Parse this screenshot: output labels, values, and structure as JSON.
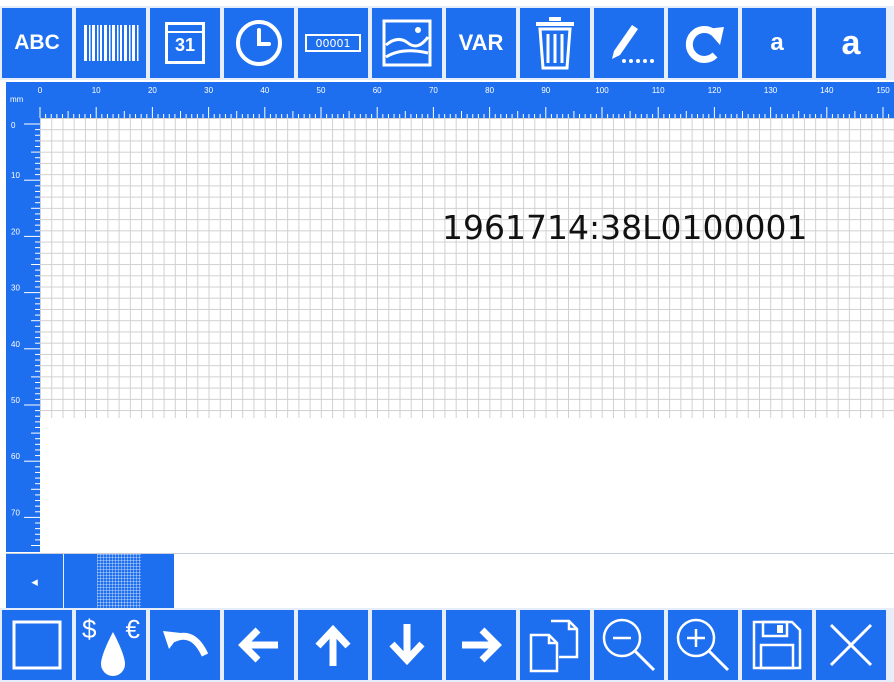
{
  "toolbar_top": {
    "buttons": [
      {
        "name": "text-tool",
        "label": "ABC",
        "icon": "text-abc-icon"
      },
      {
        "name": "barcode-tool",
        "icon": "barcode-icon"
      },
      {
        "name": "date-tool",
        "label": "31",
        "icon": "calendar-icon"
      },
      {
        "name": "time-tool",
        "icon": "clock-icon"
      },
      {
        "name": "counter-tool",
        "label": "00001",
        "icon": "counter-icon"
      },
      {
        "name": "image-tool",
        "icon": "image-icon"
      },
      {
        "name": "variable-tool",
        "label": "VAR",
        "icon": "variable-icon"
      },
      {
        "name": "delete-tool",
        "icon": "trash-icon"
      },
      {
        "name": "edit-tool",
        "icon": "pencil-icon"
      },
      {
        "name": "rotate-tool",
        "icon": "rotate-icon"
      },
      {
        "name": "font-small-tool",
        "label": "a",
        "icon": "font-small-icon"
      },
      {
        "name": "font-large-tool",
        "label": "a",
        "icon": "font-large-icon"
      }
    ]
  },
  "ruler": {
    "unit": "mm",
    "h_labels": [
      "0",
      "10",
      "20",
      "30",
      "40",
      "50",
      "60",
      "70",
      "80",
      "90",
      "100",
      "110",
      "120",
      "130",
      "140",
      "150"
    ],
    "v_labels": [
      "0",
      "10",
      "20",
      "30",
      "40",
      "50",
      "60",
      "70"
    ]
  },
  "canvas": {
    "field_text": "1961714:38L0100001"
  },
  "scrollbar": {
    "left_arrow": "◂"
  },
  "toolbar_bottom": {
    "buttons": [
      {
        "name": "select-box",
        "icon": "square-icon"
      },
      {
        "name": "ink-cost",
        "label_left": "$",
        "label_right": "€",
        "icon": "ink-drop-icon"
      },
      {
        "name": "undo",
        "icon": "undo-icon"
      },
      {
        "name": "move-left",
        "icon": "arrow-left-icon"
      },
      {
        "name": "move-up",
        "icon": "arrow-up-icon"
      },
      {
        "name": "move-down",
        "icon": "arrow-down-icon"
      },
      {
        "name": "move-right",
        "icon": "arrow-right-icon"
      },
      {
        "name": "copy",
        "icon": "copy-icon"
      },
      {
        "name": "zoom-out",
        "icon": "zoom-out-icon"
      },
      {
        "name": "zoom-in",
        "icon": "zoom-in-icon"
      },
      {
        "name": "save",
        "icon": "save-icon"
      },
      {
        "name": "close",
        "icon": "close-icon"
      }
    ]
  },
  "colors": {
    "accent": "#1e6ff0",
    "grid": "#d0d0d0",
    "toolbar_bg": "#e8eef8"
  }
}
